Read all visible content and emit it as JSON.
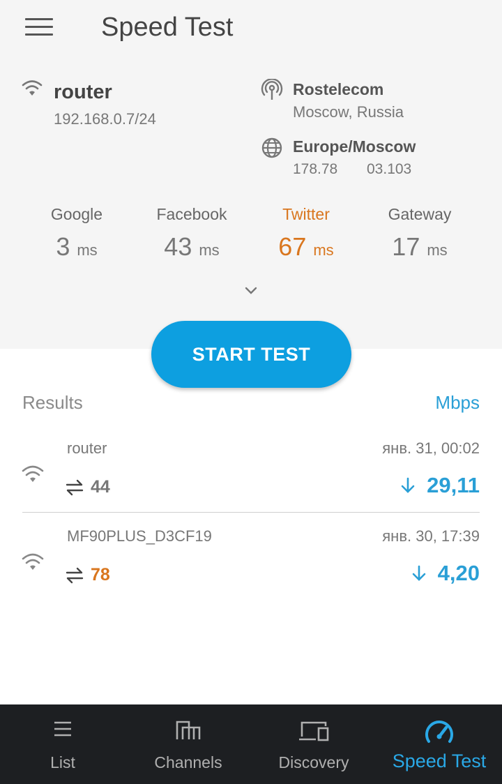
{
  "header": {
    "title": "Speed Test"
  },
  "network": {
    "name": "router",
    "ip": "192.168.0.7/24"
  },
  "isp": {
    "name": "Rostelecom",
    "location": "Moscow, Russia"
  },
  "timezone": {
    "name": "Europe/Moscow",
    "lat": "178.78",
    "lon": "03.103"
  },
  "pings": [
    {
      "name": "Google",
      "value": "3",
      "unit": "ms"
    },
    {
      "name": "Facebook",
      "value": "43",
      "unit": "ms"
    },
    {
      "name": "Twitter",
      "value": "67",
      "unit": "ms"
    },
    {
      "name": "Gateway",
      "value": "17",
      "unit": "ms"
    }
  ],
  "start_button": "START TEST",
  "results": {
    "label": "Results",
    "units": "Mbps",
    "items": [
      {
        "name": "router",
        "time": "янв. 31, 00:02",
        "ping": "44",
        "speed": "29,11"
      },
      {
        "name": "MF90PLUS_D3CF19",
        "time": "янв. 30, 17:39",
        "ping": "78",
        "speed": "4,20"
      }
    ]
  },
  "nav": [
    {
      "label": "List",
      "icon": "list-icon"
    },
    {
      "label": "Channels",
      "icon": "channels-icon"
    },
    {
      "label": "Discovery",
      "icon": "discovery-icon"
    },
    {
      "label": "Speed Test",
      "icon": "speedometer-icon"
    }
  ],
  "colors": {
    "accent": "#0d9fe0",
    "warning": "#d9761e",
    "nav_bg": "#1d1f22"
  }
}
